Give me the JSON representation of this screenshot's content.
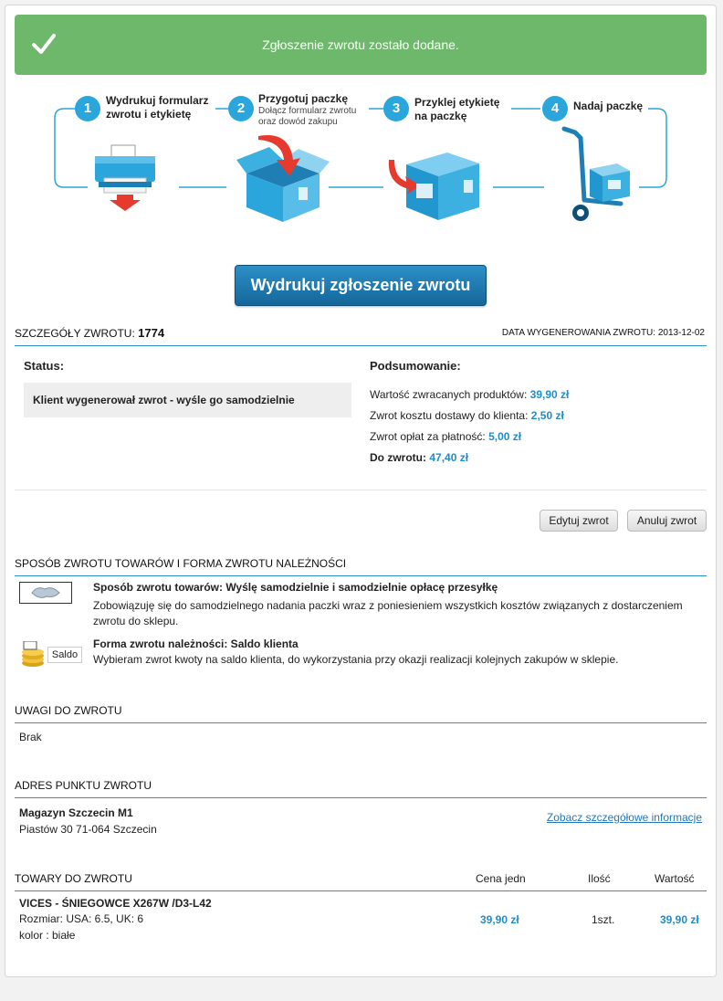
{
  "banner": {
    "message": "Zgłoszenie zwrotu zostało dodane."
  },
  "steps": [
    {
      "num": "1",
      "title1": "Wydrukuj formularz",
      "title2": "zwrotu i etykietę",
      "sub1": "",
      "sub2": ""
    },
    {
      "num": "2",
      "title1": "Przygotuj paczkę",
      "title2": "",
      "sub1": "Dołącz formularz zwrotu",
      "sub2": "oraz dowód zakupu"
    },
    {
      "num": "3",
      "title1": "Przyklej etykietę",
      "title2": "na paczkę",
      "sub1": "",
      "sub2": ""
    },
    {
      "num": "4",
      "title1": "Nadaj paczkę",
      "title2": "",
      "sub1": "",
      "sub2": ""
    }
  ],
  "print_button": "Wydrukuj zgłoszenie zwrotu",
  "details": {
    "label": "SZCZEGÓŁY ZWROTU:",
    "number": "1774",
    "generated_label": "DATA WYGENEROWANIA ZWROTU:",
    "generated_date": "2013-12-02",
    "status_label": "Status:",
    "status_value": "Klient wygenerował zwrot - wyśle go samodzielnie",
    "summary_label": "Podsumowanie:",
    "summary": [
      {
        "label": "Wartość zwracanych produktów:",
        "value": "39,90 zł"
      },
      {
        "label": "Zwrot kosztu dostawy do klienta:",
        "value": "2,50 zł"
      },
      {
        "label": "Zwrot opłat za płatność:",
        "value": "5,00 zł"
      }
    ],
    "total_label": "Do zwrotu:",
    "total_value": "47,40 zł",
    "edit_button": "Edytuj zwrot",
    "cancel_button": "Anuluj zwrot"
  },
  "method": {
    "heading": "SPOSÓB ZWROTU TOWARÓW I FORMA ZWROTU NALEŻNOŚCI",
    "goods_title": "Sposób zwrotu towarów: Wyślę samodzielnie i samodzielnie opłacę przesyłkę",
    "goods_desc1": "Zobowiązuję się do samodzielnego nadania paczki wraz z poniesieniem wszystkich kosztów związanych z dostarczeniem",
    "goods_desc2": "zwrotu do sklepu.",
    "refund_title": "Forma zwrotu należności: Saldo klienta",
    "refund_desc": "Wybieram zwrot kwoty na saldo klienta, do wykorzystania przy okazji realizacji kolejnych zakupów w sklepie.",
    "saldo_label": "Saldo"
  },
  "notes": {
    "heading": "UWAGI DO ZWROTU",
    "value": "Brak"
  },
  "address": {
    "heading": "ADRES PUNKTU ZWROTU",
    "name": "Magazyn Szczecin M1",
    "line": "Piastów 30 71-064 Szczecin",
    "link": "Zobacz szczegółowe informacje"
  },
  "items": {
    "heading": "TOWARY DO ZWROTU",
    "col_price": "Cena jedn",
    "col_qty": "Ilość",
    "col_value": "Wartość",
    "rows": [
      {
        "name": "VICES - ŚNIEGOWCE X267W /D3-L42",
        "size": "Rozmiar: USA: 6.5, UK: 6",
        "color": "kolor : białe",
        "price": "39,90 zł",
        "qty": "1szt.",
        "value": "39,90 zł"
      }
    ]
  },
  "colors": {
    "banner": "#6db86a",
    "accent": "#1f8dcb",
    "step_circle": "#2aa6dc"
  }
}
